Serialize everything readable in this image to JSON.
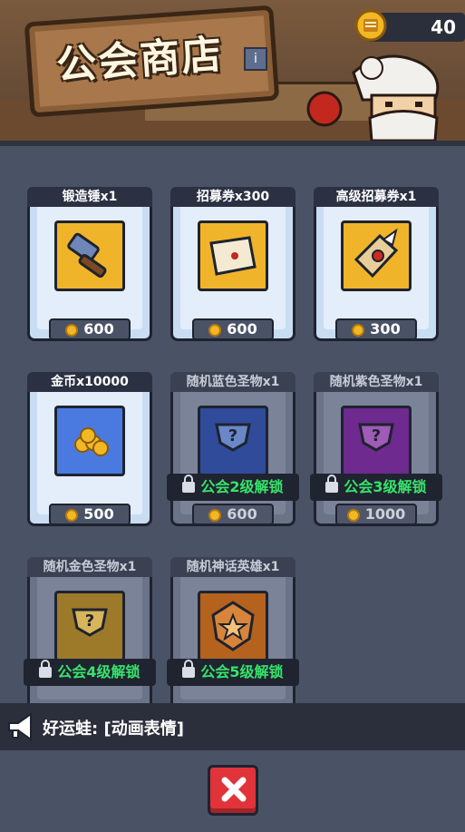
{
  "header": {
    "title": "公会商店",
    "info_label": "i",
    "coin_count": "40"
  },
  "shop_items": [
    {
      "name": "锻造锤x1",
      "price": "600",
      "icon": "hammer-icon",
      "locked": false,
      "icon_bg": "#f0b42a"
    },
    {
      "name": "招募券x300",
      "price": "600",
      "icon": "scroll-icon",
      "locked": false,
      "icon_bg": "#f0b42a"
    },
    {
      "name": "高级招募券x1",
      "price": "300",
      "icon": "premium-scroll-icon",
      "locked": false,
      "icon_bg": "#f0b42a"
    },
    {
      "name": "金币x10000",
      "price": "500",
      "icon": "gold-coins-icon",
      "locked": false,
      "icon_bg": "#4a7ae0"
    },
    {
      "name": "随机蓝色圣物x1",
      "price": "600",
      "icon": "blue-relic-icon",
      "locked": true,
      "lock_text": "公会2级解锁",
      "icon_bg": "#2f4b9a"
    },
    {
      "name": "随机紫色圣物x1",
      "price": "1000",
      "icon": "purple-relic-icon",
      "locked": true,
      "lock_text": "公会3级解锁",
      "icon_bg": "#6e2a8e"
    },
    {
      "name": "随机金色圣物x1",
      "price": "",
      "icon": "gold-relic-icon",
      "locked": true,
      "lock_text": "公会4级解锁",
      "icon_bg": "#9c7a2a"
    },
    {
      "name": "随机神话英雄x1",
      "price": "",
      "icon": "mythic-hero-icon",
      "locked": true,
      "lock_text": "公会5级解锁",
      "icon_bg": "#b5621f"
    }
  ],
  "chat": {
    "message": "好运蛙: [动画表情]"
  },
  "colors": {
    "unlock_text": "#37e36b",
    "close_button": "#e0343a",
    "coin": "#f2b824"
  }
}
